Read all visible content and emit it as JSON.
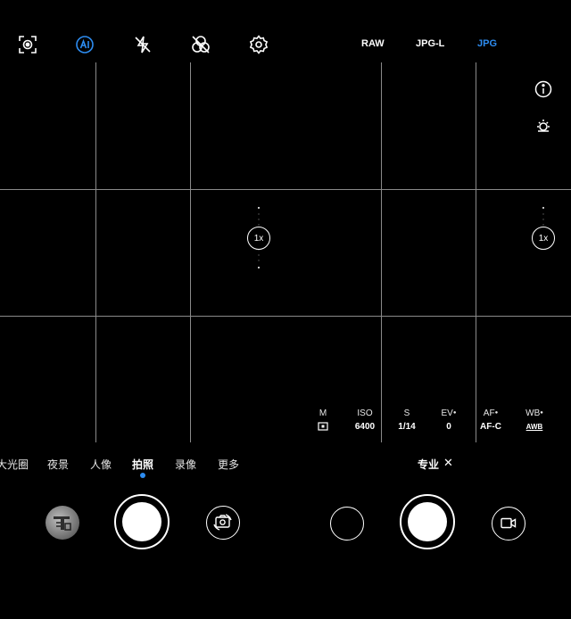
{
  "top_bar": {
    "icons": [
      "scene-frame-icon",
      "ai-icon",
      "flash-off-icon",
      "filter-icon",
      "settings-icon"
    ],
    "ai_color": "#2d8cf0",
    "formats": [
      {
        "label": "RAW",
        "active": false
      },
      {
        "label": "JPG-L",
        "active": false
      },
      {
        "label": "JPG",
        "active": true
      }
    ]
  },
  "side_icons": [
    "info-icon",
    "brightness-icon"
  ],
  "zoom": {
    "left_label": "1x",
    "right_label": "1x"
  },
  "pro_params": [
    {
      "label": "M",
      "value": "",
      "mark": false,
      "value_icon": "metering-icon"
    },
    {
      "label": "ISO",
      "value": "6400",
      "mark": false
    },
    {
      "label": "S",
      "value": "1/14",
      "mark": false
    },
    {
      "label": "EV",
      "value": "0",
      "mark": true
    },
    {
      "label": "AF",
      "value": "AF-C",
      "mark": true
    },
    {
      "label": "WB",
      "value": "AWB",
      "mark": true
    }
  ],
  "modes": [
    {
      "label": "大光圈",
      "active": false
    },
    {
      "label": "夜景",
      "active": false
    },
    {
      "label": "人像",
      "active": false
    },
    {
      "label": "拍照",
      "active": true
    },
    {
      "label": "录像",
      "active": false
    },
    {
      "label": "更多",
      "active": false
    }
  ],
  "pro_mode": {
    "label": "专业",
    "close_glyph": "✕"
  },
  "bottom_controls": {
    "left": [
      "gallery-thumbnail",
      "shutter-button",
      "switch-camera-icon"
    ],
    "right": [
      "secondary-circle",
      "shutter-button",
      "video-icon"
    ]
  },
  "accent_color": "#2d8cf0"
}
